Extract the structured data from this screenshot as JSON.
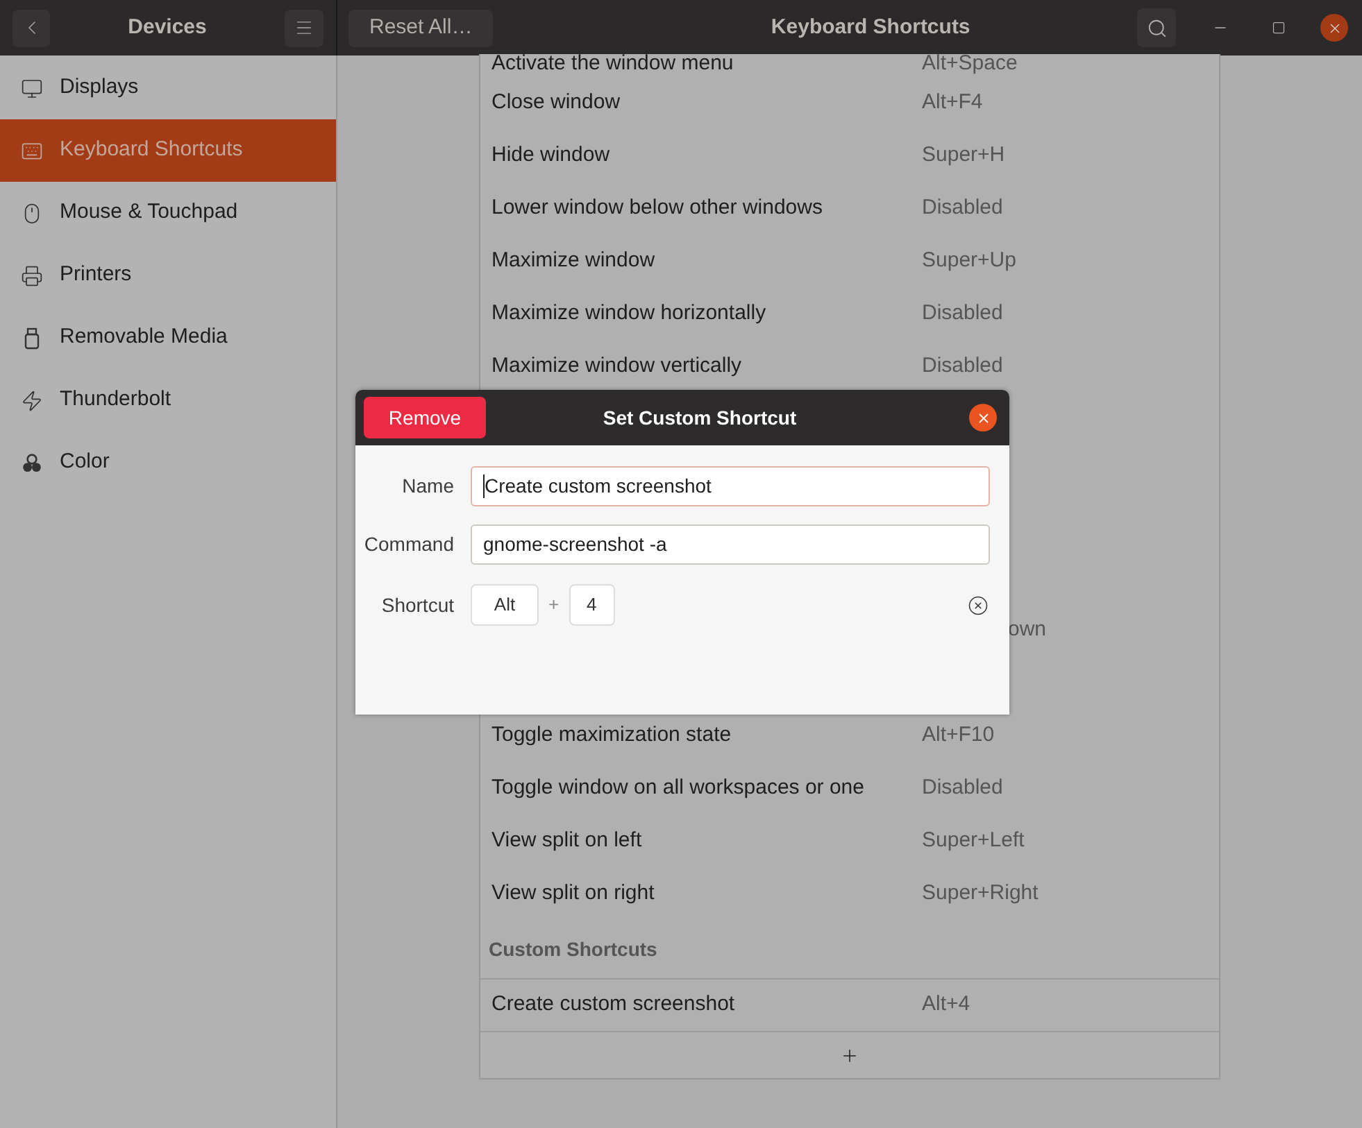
{
  "header": {
    "sidebar_title": "Devices",
    "reset_button": "Reset All…",
    "title": "Keyboard Shortcuts"
  },
  "sidebar": {
    "items": [
      {
        "label": "Displays",
        "selected": false
      },
      {
        "label": "Keyboard Shortcuts",
        "selected": true
      },
      {
        "label": "Mouse & Touchpad",
        "selected": false
      },
      {
        "label": "Printers",
        "selected": false
      },
      {
        "label": "Removable Media",
        "selected": false
      },
      {
        "label": "Thunderbolt",
        "selected": false
      },
      {
        "label": "Color",
        "selected": false
      }
    ]
  },
  "shortcuts": {
    "rows": [
      {
        "kind": "partial",
        "name": "Activate the window menu",
        "shortcut": "Alt+Space"
      },
      {
        "kind": "row",
        "name": "Close window",
        "shortcut": "Alt+F4"
      },
      {
        "kind": "row",
        "name": "Hide window",
        "shortcut": "Super+H"
      },
      {
        "kind": "row",
        "name": "Lower window below other windows",
        "shortcut": "Disabled"
      },
      {
        "kind": "row",
        "name": "Maximize window",
        "shortcut": "Super+Up"
      },
      {
        "kind": "row",
        "name": "Maximize window horizontally",
        "shortcut": "Disabled"
      },
      {
        "kind": "row",
        "name": "Maximize window vertically",
        "shortcut": "Disabled"
      },
      {
        "kind": "hidden"
      },
      {
        "kind": "hidden"
      },
      {
        "kind": "hidden"
      },
      {
        "kind": "hidden"
      },
      {
        "kind": "hidden",
        "fragment": "own"
      },
      {
        "kind": "hidden"
      },
      {
        "kind": "row",
        "name": "Toggle maximization state",
        "shortcut": "Alt+F10"
      },
      {
        "kind": "row",
        "name": "Toggle window on all workspaces or one",
        "shortcut": "Disabled"
      },
      {
        "kind": "row",
        "name": "View split on left",
        "shortcut": "Super+Left"
      },
      {
        "kind": "row",
        "name": "View split on right",
        "shortcut": "Super+Right"
      }
    ],
    "custom_heading": "Custom Shortcuts",
    "custom_rows": [
      {
        "name": "Create custom screenshot",
        "shortcut": "Alt+4"
      }
    ]
  },
  "dialog": {
    "title": "Set Custom Shortcut",
    "remove_button": "Remove",
    "fields": [
      {
        "label": "Name",
        "value": "Create custom screenshot",
        "focused": true
      },
      {
        "label": "Command",
        "value": "gnome-screenshot -a",
        "focused": false
      }
    ],
    "shortcut": {
      "label": "Shortcut",
      "keys": [
        "Alt",
        "4"
      ],
      "separator": "+"
    }
  }
}
